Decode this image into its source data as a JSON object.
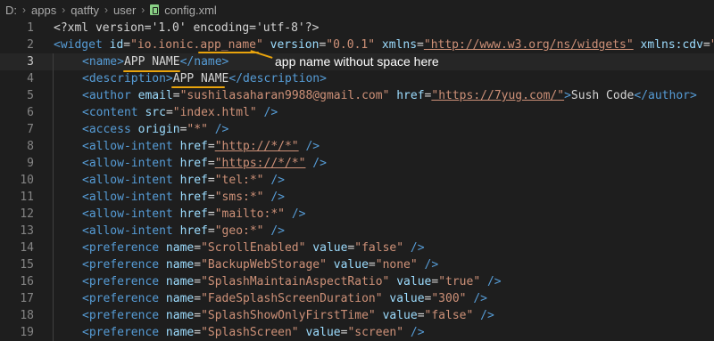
{
  "breadcrumb": [
    "D:",
    "apps",
    "qatfty",
    "user",
    "config.xml"
  ],
  "annotation": "app name without  space  here",
  "lines": [
    {
      "n": "1",
      "parts": [
        [
          "txt",
          "<?xml version='1.0' encoding='utf-8'?>"
        ]
      ]
    },
    {
      "n": "2",
      "parts": [
        [
          "tag",
          "<widget "
        ],
        [
          "attr",
          "id"
        ],
        [
          "txt",
          "="
        ],
        [
          "str",
          "\"io.ionic.app_name\""
        ],
        [
          "txt",
          " "
        ],
        [
          "attr",
          "version"
        ],
        [
          "txt",
          "="
        ],
        [
          "str",
          "\"0.0.1\""
        ],
        [
          "txt",
          " "
        ],
        [
          "attr",
          "xmlns"
        ],
        [
          "txt",
          "="
        ],
        [
          "str",
          "\"http://www.w3.org/ns/widgets\""
        ],
        [
          "txt",
          " "
        ],
        [
          "attr",
          "xmlns:cdv"
        ],
        [
          "txt",
          "="
        ],
        [
          "str",
          "\"h"
        ]
      ]
    },
    {
      "n": "3",
      "parts": [
        [
          "tag",
          "<name>"
        ],
        [
          "txt",
          "APP NAME"
        ],
        [
          "tag",
          "</name>"
        ]
      ],
      "active": true
    },
    {
      "n": "4",
      "parts": [
        [
          "tag",
          "<description>"
        ],
        [
          "txt",
          "APP NAME"
        ],
        [
          "tag",
          "</description>"
        ]
      ]
    },
    {
      "n": "5",
      "parts": [
        [
          "tag",
          "<author "
        ],
        [
          "attr",
          "email"
        ],
        [
          "txt",
          "="
        ],
        [
          "str",
          "\"sushilasaharan9988@gmail.com\""
        ],
        [
          "txt",
          " "
        ],
        [
          "attr",
          "href"
        ],
        [
          "txt",
          "="
        ],
        [
          "str",
          "\"https://7yug.com/\""
        ],
        [
          "tag",
          ">"
        ],
        [
          "txt",
          "Sush Code"
        ],
        [
          "tag",
          "</author>"
        ]
      ]
    },
    {
      "n": "6",
      "parts": [
        [
          "tag",
          "<content "
        ],
        [
          "attr",
          "src"
        ],
        [
          "txt",
          "="
        ],
        [
          "str",
          "\"index.html\""
        ],
        [
          "tag",
          " />"
        ]
      ]
    },
    {
      "n": "7",
      "parts": [
        [
          "tag",
          "<access "
        ],
        [
          "attr",
          "origin"
        ],
        [
          "txt",
          "="
        ],
        [
          "str",
          "\"*\""
        ],
        [
          "tag",
          " />"
        ]
      ]
    },
    {
      "n": "8",
      "parts": [
        [
          "tag",
          "<allow-intent "
        ],
        [
          "attr",
          "href"
        ],
        [
          "txt",
          "="
        ],
        [
          "str",
          "\"http://*/*\""
        ],
        [
          "tag",
          " />"
        ]
      ]
    },
    {
      "n": "9",
      "parts": [
        [
          "tag",
          "<allow-intent "
        ],
        [
          "attr",
          "href"
        ],
        [
          "txt",
          "="
        ],
        [
          "str",
          "\"https://*/*\""
        ],
        [
          "tag",
          " />"
        ]
      ]
    },
    {
      "n": "10",
      "parts": [
        [
          "tag",
          "<allow-intent "
        ],
        [
          "attr",
          "href"
        ],
        [
          "txt",
          "="
        ],
        [
          "str",
          "\"tel:*\""
        ],
        [
          "tag",
          " />"
        ]
      ]
    },
    {
      "n": "11",
      "parts": [
        [
          "tag",
          "<allow-intent "
        ],
        [
          "attr",
          "href"
        ],
        [
          "txt",
          "="
        ],
        [
          "str",
          "\"sms:*\""
        ],
        [
          "tag",
          " />"
        ]
      ]
    },
    {
      "n": "12",
      "parts": [
        [
          "tag",
          "<allow-intent "
        ],
        [
          "attr",
          "href"
        ],
        [
          "txt",
          "="
        ],
        [
          "str",
          "\"mailto:*\""
        ],
        [
          "tag",
          " />"
        ]
      ]
    },
    {
      "n": "13",
      "parts": [
        [
          "tag",
          "<allow-intent "
        ],
        [
          "attr",
          "href"
        ],
        [
          "txt",
          "="
        ],
        [
          "str",
          "\"geo:*\""
        ],
        [
          "tag",
          " />"
        ]
      ]
    },
    {
      "n": "14",
      "parts": [
        [
          "tag",
          "<preference "
        ],
        [
          "attr",
          "name"
        ],
        [
          "txt",
          "="
        ],
        [
          "str",
          "\"ScrollEnabled\""
        ],
        [
          "txt",
          " "
        ],
        [
          "attr",
          "value"
        ],
        [
          "txt",
          "="
        ],
        [
          "str",
          "\"false\""
        ],
        [
          "tag",
          " />"
        ]
      ]
    },
    {
      "n": "15",
      "parts": [
        [
          "tag",
          "<preference "
        ],
        [
          "attr",
          "name"
        ],
        [
          "txt",
          "="
        ],
        [
          "str",
          "\"BackupWebStorage\""
        ],
        [
          "txt",
          " "
        ],
        [
          "attr",
          "value"
        ],
        [
          "txt",
          "="
        ],
        [
          "str",
          "\"none\""
        ],
        [
          "tag",
          " />"
        ]
      ]
    },
    {
      "n": "16",
      "parts": [
        [
          "tag",
          "<preference "
        ],
        [
          "attr",
          "name"
        ],
        [
          "txt",
          "="
        ],
        [
          "str",
          "\"SplashMaintainAspectRatio\""
        ],
        [
          "txt",
          " "
        ],
        [
          "attr",
          "value"
        ],
        [
          "txt",
          "="
        ],
        [
          "str",
          "\"true\""
        ],
        [
          "tag",
          " />"
        ]
      ]
    },
    {
      "n": "17",
      "parts": [
        [
          "tag",
          "<preference "
        ],
        [
          "attr",
          "name"
        ],
        [
          "txt",
          "="
        ],
        [
          "str",
          "\"FadeSplashScreenDuration\""
        ],
        [
          "txt",
          " "
        ],
        [
          "attr",
          "value"
        ],
        [
          "txt",
          "="
        ],
        [
          "str",
          "\"300\""
        ],
        [
          "tag",
          " />"
        ]
      ]
    },
    {
      "n": "18",
      "parts": [
        [
          "tag",
          "<preference "
        ],
        [
          "attr",
          "name"
        ],
        [
          "txt",
          "="
        ],
        [
          "str",
          "\"SplashShowOnlyFirstTime\""
        ],
        [
          "txt",
          " "
        ],
        [
          "attr",
          "value"
        ],
        [
          "txt",
          "="
        ],
        [
          "str",
          "\"false\""
        ],
        [
          "tag",
          " />"
        ]
      ]
    },
    {
      "n": "19",
      "parts": [
        [
          "tag",
          "<preference "
        ],
        [
          "attr",
          "name"
        ],
        [
          "txt",
          "="
        ],
        [
          "str",
          "\"SplashScreen\""
        ],
        [
          "txt",
          " "
        ],
        [
          "attr",
          "value"
        ],
        [
          "txt",
          "="
        ],
        [
          "str",
          "\"screen\""
        ],
        [
          "tag",
          " />"
        ]
      ]
    }
  ]
}
